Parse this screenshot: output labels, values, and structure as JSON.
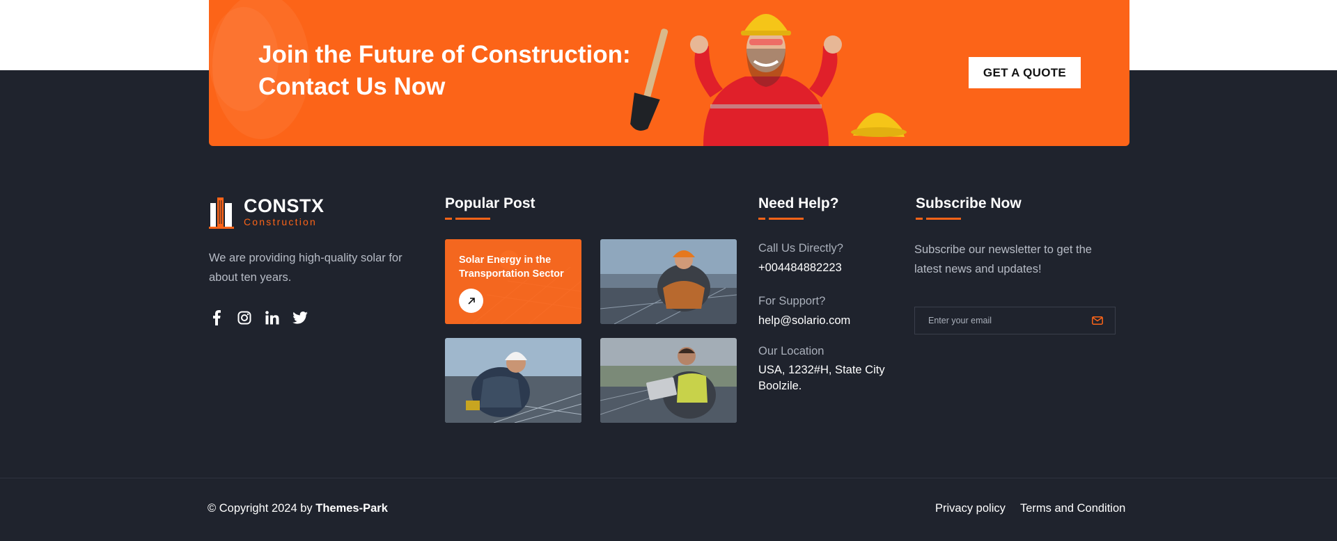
{
  "cta": {
    "title_line1": "Join the Future of Construction:",
    "title_line2": "Contact Us Now",
    "button_label": "GET A QUOTE"
  },
  "brand": {
    "name": "CONSTX",
    "tagline": "Construction",
    "about": "We are providing high-quality solar for about ten years.",
    "accent": "#fc6418"
  },
  "socials": [
    {
      "icon": "facebook-icon"
    },
    {
      "icon": "instagram-icon"
    },
    {
      "icon": "linkedin-icon"
    },
    {
      "icon": "twitter-icon"
    }
  ],
  "popular_post": {
    "title": "Popular Post",
    "featured_title": "Solar Energy in the Transportation Sector"
  },
  "help": {
    "title": "Need Help?",
    "call_label": "Call Us Directly?",
    "call_value": "+004484882223",
    "support_label": "For Support?",
    "support_value": "help@solario.com",
    "location_label": "Our Location",
    "location_value": "USA, 1232#H, State City Boolzile."
  },
  "subscribe": {
    "title": "Subscribe Now",
    "text": "Subscribe our newsletter to get the latest news and updates!",
    "placeholder": "Enter your email"
  },
  "bottom": {
    "copyright_prefix": "© Copyright 2024 by ",
    "copyright_owner": "Themes-Park",
    "privacy": "Privacy policy",
    "terms": "Terms and Condition"
  },
  "colors": {
    "footer_bg": "#1f232d",
    "accent": "#fc6418"
  }
}
